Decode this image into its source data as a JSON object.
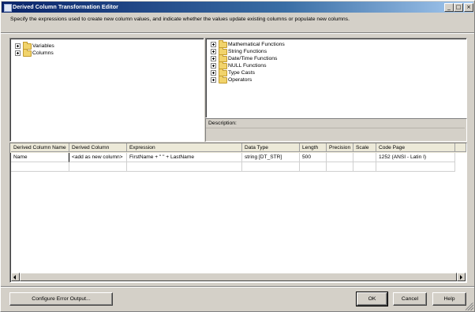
{
  "window": {
    "title": "Derived Column Transformation Editor",
    "controls": {
      "minimize": "_",
      "maximize": "□",
      "close": "×"
    }
  },
  "instructions": "Specify the expressions used to create new column values, and indicate whether the values update existing columns or populate new columns.",
  "left_tree": {
    "items": [
      {
        "label": "Variables",
        "icon": "folder-icon",
        "expander": "plus"
      },
      {
        "label": "Columns",
        "icon": "folder-icon",
        "expander": "plus"
      }
    ]
  },
  "right_tree": {
    "items": [
      {
        "label": "Mathematical Functions",
        "icon": "folder-icon",
        "expander": "plus"
      },
      {
        "label": "String Functions",
        "icon": "folder-icon",
        "expander": "plus"
      },
      {
        "label": "Date/Time Functions",
        "icon": "folder-icon",
        "expander": "plus"
      },
      {
        "label": "NULL Functions",
        "icon": "folder-icon",
        "expander": "plus"
      },
      {
        "label": "Type Casts",
        "icon": "folder-icon",
        "expander": "plus"
      },
      {
        "label": "Operators",
        "icon": "folder-icon",
        "expander": "plus"
      }
    ]
  },
  "description": {
    "label": "Description:",
    "text": ""
  },
  "grid": {
    "columns": [
      "Derived Column Name",
      "Derived Column",
      "Expression",
      "Data Type",
      "Length",
      "Precision",
      "Scale",
      "Code Page"
    ],
    "rows": [
      [
        "Name",
        "<add as new column>",
        "FirstName + \" \" + LastName",
        "string [DT_STR]",
        "500",
        "",
        "",
        "1252  (ANSI - Latin I)"
      ]
    ]
  },
  "buttons": {
    "configure_error_output": "Configure Error Output...",
    "ok": "OK",
    "cancel": "Cancel",
    "help": "Help"
  }
}
